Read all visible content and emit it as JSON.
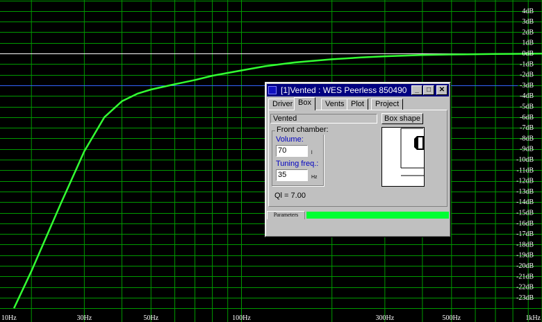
{
  "chart_data": {
    "type": "line",
    "x_scale": "log",
    "xlim": [
      10,
      1000
    ],
    "ylim": [
      -24,
      5
    ],
    "grid": true,
    "x_ticks": [
      {
        "value": 10,
        "label": "10Hz"
      },
      {
        "value": 30,
        "label": "30Hz"
      },
      {
        "value": 50,
        "label": "50Hz"
      },
      {
        "value": 100,
        "label": "100Hz"
      },
      {
        "value": 300,
        "label": "300Hz"
      },
      {
        "value": 500,
        "label": "500Hz"
      },
      {
        "value": 1000,
        "label": "1kHz"
      }
    ],
    "y_ticks": [
      {
        "value": 4,
        "label": "4dB"
      },
      {
        "value": 3,
        "label": "3dB"
      },
      {
        "value": 2,
        "label": "2dB"
      },
      {
        "value": 1,
        "label": "1dB"
      },
      {
        "value": 0,
        "label": "0dB"
      },
      {
        "value": -1,
        "label": "-1dB"
      },
      {
        "value": -2,
        "label": "-2dB"
      },
      {
        "value": -3,
        "label": "-3dB"
      },
      {
        "value": -4,
        "label": "-4dB"
      },
      {
        "value": -5,
        "label": "-5dB"
      },
      {
        "value": -6,
        "label": "-6dB"
      },
      {
        "value": -7,
        "label": "-7dB"
      },
      {
        "value": -8,
        "label": "-8dB"
      },
      {
        "value": -9,
        "label": "-9dB"
      },
      {
        "value": -10,
        "label": "-10dB"
      },
      {
        "value": -11,
        "label": "-11dB"
      },
      {
        "value": -12,
        "label": "-12dB"
      },
      {
        "value": -13,
        "label": "-13dB"
      },
      {
        "value": -14,
        "label": "-14dB"
      },
      {
        "value": -15,
        "label": "-15dB"
      },
      {
        "value": -16,
        "label": "-16dB"
      },
      {
        "value": -17,
        "label": "-17dB"
      },
      {
        "value": -18,
        "label": "-18dB"
      },
      {
        "value": -19,
        "label": "-19dB"
      },
      {
        "value": -20,
        "label": "-20dB"
      },
      {
        "value": -21,
        "label": "-21dB"
      },
      {
        "value": -22,
        "label": "-22dB"
      },
      {
        "value": -23,
        "label": "-23dB"
      }
    ],
    "reference_lines": [
      {
        "y": 0,
        "color": "#ffffff"
      },
      {
        "y": -3,
        "color": "#3366ff"
      }
    ],
    "series": [
      {
        "color": "#33ff33",
        "x": [
          17.5,
          20,
          25,
          30,
          35,
          40,
          45,
          50,
          60,
          70,
          80,
          100,
          120,
          150,
          200,
          250,
          300,
          400,
          500,
          600,
          700,
          800,
          1000
        ],
        "y": [
          -24,
          -20.5,
          -14.2,
          -9.2,
          -6.0,
          -4.5,
          -3.8,
          -3.4,
          -2.9,
          -2.5,
          -2.1,
          -1.6,
          -1.2,
          -0.85,
          -0.55,
          -0.38,
          -0.27,
          -0.15,
          -0.1,
          -0.07,
          -0.05,
          -0.04,
          -0.02
        ]
      }
    ]
  },
  "window": {
    "title": "[1]Vented : WES Peerless 850490",
    "min_glyph": "_",
    "max_glyph": "□",
    "close_glyph": "✕",
    "tabs": [
      "Driver",
      "Box",
      "Vents",
      "Plot",
      "Project"
    ],
    "active_tab": "Box",
    "box_type": "Vented",
    "box_shape_button": "Box shape",
    "group_label": "Front chamber:",
    "volume_label": "Volume:",
    "volume_value": "70",
    "volume_unit": "l",
    "tuning_label": "Tuning freq.:",
    "tuning_value": "35",
    "tuning_unit": "Hz",
    "ql_text": "Ql = 7.00",
    "status_tab": "Parameters",
    "progress_fraction": 1.0,
    "accent_colors": {
      "titlebar": "#000080",
      "progress": "#00ff33",
      "grid": "#00a000",
      "curve": "#33ff33"
    }
  }
}
